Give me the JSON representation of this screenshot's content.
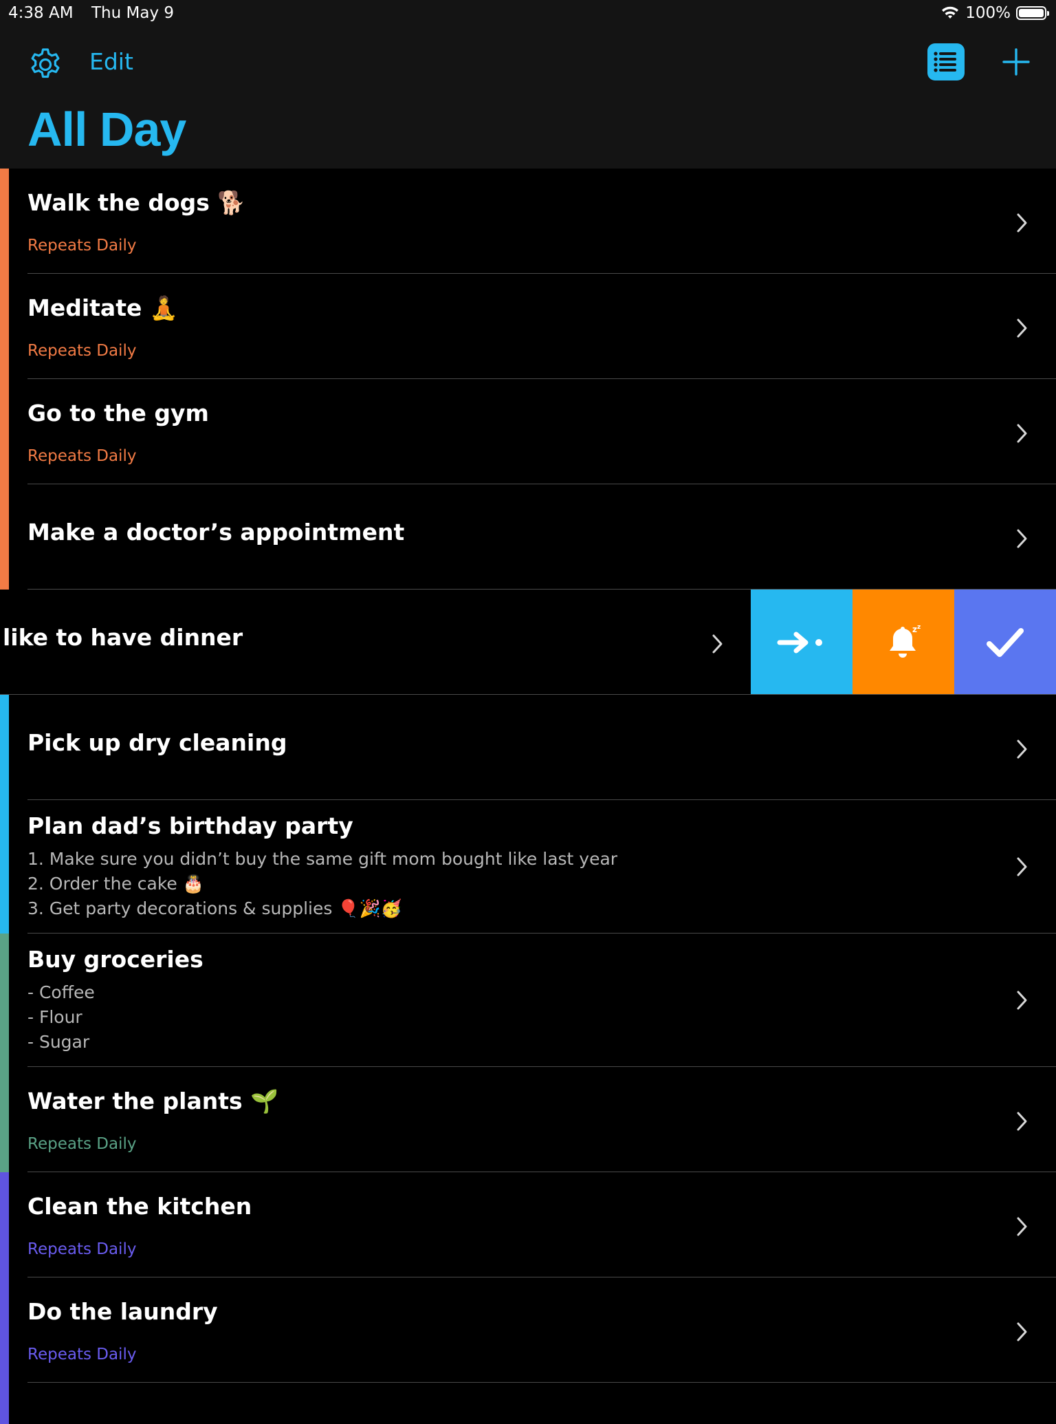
{
  "status": {
    "time": "4:38 AM",
    "date": "Thu May 9",
    "battery": "100%",
    "battery_level": 1.0
  },
  "toolbar": {
    "edit_label": "Edit"
  },
  "page": {
    "title": "All Day"
  },
  "colors": {
    "accent": "#26b8f0",
    "orange": "#f27b45",
    "blue": "#26b8f0",
    "green": "#5aa286",
    "purple": "#5f54e0",
    "action_move": "#26b8f0",
    "action_snooze": "#ff8800",
    "action_complete": "#5a76f0"
  },
  "tasks": [
    {
      "title": "Walk the dogs 🐕",
      "subtitle": "Repeats Daily",
      "color": "orange"
    },
    {
      "title": "Meditate 🧘",
      "subtitle": "Repeats Daily",
      "color": "orange"
    },
    {
      "title": "Go to the gym",
      "subtitle": "Repeats Daily",
      "color": "orange"
    },
    {
      "title": "Make a doctor’s appointment",
      "color": "orange"
    },
    {
      "title": "like to have dinner",
      "swiped": true,
      "actions": [
        {
          "icon": "move-to-icon"
        },
        {
          "icon": "snooze-bell-icon"
        },
        {
          "icon": "checkmark-icon"
        }
      ]
    },
    {
      "title": "Pick up dry cleaning",
      "color": "blue"
    },
    {
      "title": "Plan dad’s birthday party",
      "color": "blue",
      "notes": [
        "1. Make sure you didn’t buy the same gift mom bought like last year",
        "2. Order the cake 🎂",
        "3. Get party decorations & supplies 🎈🎉🥳"
      ]
    },
    {
      "title": "Buy groceries",
      "color": "green",
      "notes": [
        "- Coffee",
        "- Flour",
        "- Sugar"
      ]
    },
    {
      "title": "Water the plants 🌱",
      "subtitle": "Repeats Daily",
      "color": "green"
    },
    {
      "title": "Clean the kitchen",
      "subtitle": "Repeats Daily",
      "color": "purple"
    },
    {
      "title": "Do the laundry",
      "subtitle": "Repeats Daily",
      "color": "purple"
    }
  ]
}
